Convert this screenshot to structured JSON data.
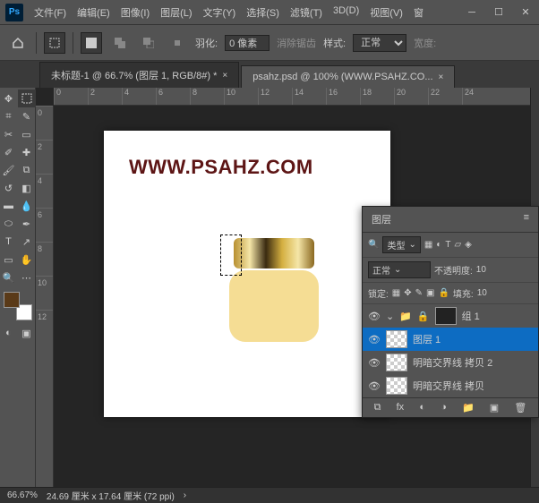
{
  "app": {
    "logo": "Ps"
  },
  "menu": [
    "文件(F)",
    "编辑(E)",
    "图像(I)",
    "图层(L)",
    "文字(Y)",
    "选择(S)",
    "滤镜(T)",
    "3D(D)",
    "视图(V)",
    "窗"
  ],
  "options": {
    "feather_label": "羽化:",
    "feather_value": "0 像素",
    "antialias": "消除锯齿",
    "style_label": "样式:",
    "style_value": "正常",
    "width_label": "宽度:"
  },
  "tabs": [
    {
      "label": "未标题-1 @ 66.7% (图层 1, RGB/8#) *",
      "active": true
    },
    {
      "label": "psahz.psd @ 100% (WWW.PSAHZ.CO...",
      "active": false
    }
  ],
  "ruler_h": [
    "0",
    "2",
    "4",
    "6",
    "8",
    "10",
    "12",
    "14",
    "16",
    "18",
    "20",
    "22",
    "24"
  ],
  "ruler_v": [
    "0",
    "2",
    "4",
    "6",
    "8",
    "10",
    "12"
  ],
  "watermark": "WWW.PSAHZ.COM",
  "swatch_fg": "#5a3a18",
  "status": {
    "zoom": "66.67%",
    "docinfo": "24.69 厘米 x 17.64 厘米 (72 ppi)"
  },
  "layers_panel": {
    "title": "图层",
    "kind_label": "类型",
    "blend_mode": "正常",
    "opacity_label": "不透明度:",
    "opacity_value": "10",
    "lock_label": "锁定:",
    "fill_label": "填充:",
    "fill_value": "10",
    "layers": [
      {
        "name": "组 1",
        "is_group": true
      },
      {
        "name": "图层 1",
        "active": true
      },
      {
        "name": "明暗交界线 拷贝 2"
      },
      {
        "name": "明暗交界线 拷贝"
      }
    ]
  },
  "chart_data": null
}
